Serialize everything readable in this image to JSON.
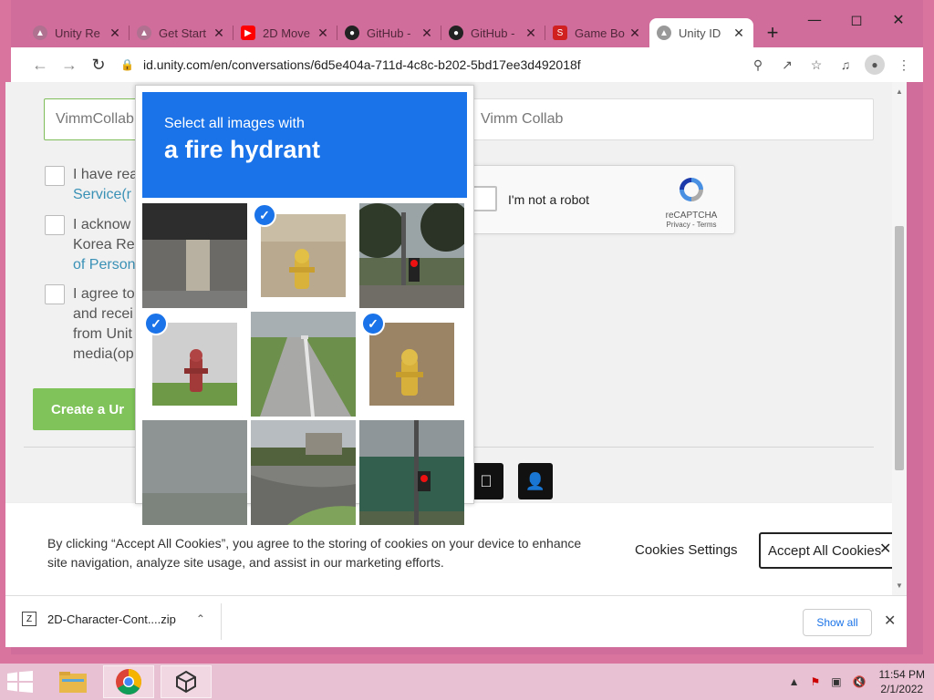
{
  "browser": {
    "tabs": [
      {
        "label": "Unity Re",
        "icon": "unity-icon",
        "color": "#aaaaaa"
      },
      {
        "label": "Get Start",
        "icon": "unity-icon",
        "color": "#aaaaaa"
      },
      {
        "label": "2D Move",
        "icon": "youtube-icon",
        "color": "#ff0000"
      },
      {
        "label": "GitHub -",
        "icon": "github-icon",
        "color": "#222222"
      },
      {
        "label": "GitHub -",
        "icon": "github-icon",
        "color": "#222222"
      },
      {
        "label": "Game Bo",
        "icon": "game-icon",
        "color": "#d02020"
      },
      {
        "label": "Unity ID",
        "icon": "unity-icon",
        "color": "#888888",
        "active": true
      }
    ],
    "url": "id.unity.com/en/conversations/6d5e404a-711d-4c8c-b202-5bd17ee3d492018f"
  },
  "form": {
    "username_value": "VimmCollab",
    "fullname_value": "Vimm Collab",
    "consents": [
      {
        "lines": [
          "I have rea",
          "Service(r"
        ],
        "link_line": 1
      },
      {
        "lines": [
          "I acknow",
          "Korea Re",
          "of Person"
        ],
        "link_line": 2
      },
      {
        "lines": [
          "I agree to",
          "and recei",
          "from Unit",
          "media(op"
        ],
        "link_line": -1
      }
    ],
    "create_button": "Create a Ur"
  },
  "recaptcha": {
    "label": "I'm not a robot",
    "brand": "reCAPTCHA",
    "terms": "Privacy - Terms"
  },
  "challenge": {
    "instruction": "Select all images with",
    "target": "a fire hydrant",
    "tiles": [
      {
        "scene": "building-underside",
        "selected": false
      },
      {
        "scene": "yellow-hydrant-gravel",
        "selected": true
      },
      {
        "scene": "traffic-light-trees",
        "selected": false
      },
      {
        "scene": "red-hydrant-sidewalk",
        "selected": true
      },
      {
        "scene": "road-hills",
        "selected": false
      },
      {
        "scene": "yellow-hydrant-pebbles",
        "selected": true
      },
      {
        "scene": "cloudy-sky",
        "selected": false
      },
      {
        "scene": "street-curb",
        "selected": false
      },
      {
        "scene": "crosswalk-signal",
        "selected": false
      }
    ]
  },
  "cookies": {
    "message": "By clicking “Accept All Cookies”, you agree to the storing of cookies on your device to enhance site navigation, analyze site usage, and assist in our marketing efforts.",
    "settings_label": "Cookies Settings",
    "accept_label": "Accept All Cookies"
  },
  "downloads": {
    "file": "2D-Character-Cont....zip",
    "show_all": "Show all"
  },
  "taskbar": {
    "time": "11:54 PM",
    "date": "2/1/2022"
  }
}
